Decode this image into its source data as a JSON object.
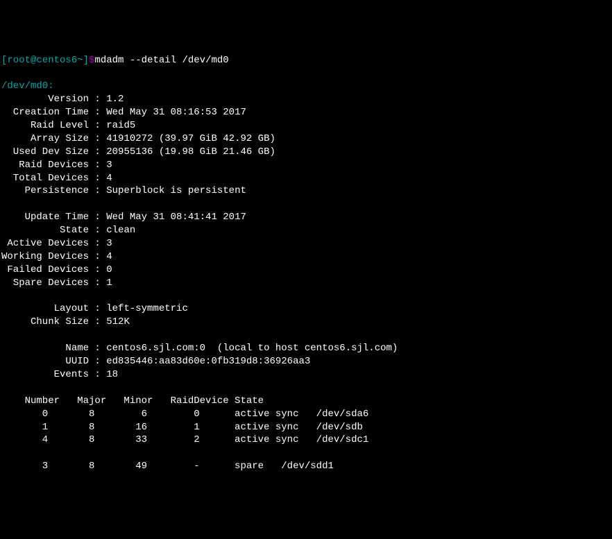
{
  "prompt": {
    "open": "[",
    "user": "root",
    "at": "@",
    "host": "centos6",
    "path": "~",
    "close": "]",
    "dollar": "$"
  },
  "command": "mdadm --detail /dev/md0",
  "device_header": "/dev/md0:",
  "details": {
    "version_label": "        Version : ",
    "version_value": "1.2",
    "creation_time_label": "  Creation Time : ",
    "creation_time_value": "Wed May 31 08:16:53 2017",
    "raid_level_label": "     Raid Level : ",
    "raid_level_value": "raid5",
    "array_size_label": "     Array Size : ",
    "array_size_value": "41910272 (39.97 GiB 42.92 GB)",
    "used_dev_size_label": "  Used Dev Size : ",
    "used_dev_size_value": "20955136 (19.98 GiB 21.46 GB)",
    "raid_devices_label": "   Raid Devices : ",
    "raid_devices_value": "3",
    "total_devices_label": "  Total Devices : ",
    "total_devices_value": "4",
    "persistence_label": "    Persistence : ",
    "persistence_value": "Superblock is persistent",
    "update_time_label": "    Update Time : ",
    "update_time_value": "Wed May 31 08:41:41 2017",
    "state_label": "          State : ",
    "state_value": "clean ",
    "active_devices_label": " Active Devices : ",
    "active_devices_value": "3",
    "working_devices_label": "Working Devices : ",
    "working_devices_value": "4",
    "failed_devices_label": " Failed Devices : ",
    "failed_devices_value": "0",
    "spare_devices_label": "  Spare Devices : ",
    "spare_devices_value": "1",
    "layout_label": "         Layout : ",
    "layout_value": "left-symmetric",
    "chunk_size_label": "     Chunk Size : ",
    "chunk_size_value": "512K",
    "name_label": "           Name : ",
    "name_value": "centos6.sjl.com:0  (local to host centos6.sjl.com)",
    "uuid_label": "           UUID : ",
    "uuid_value": "ed835446:aa83d60e:0fb319d8:36926aa3",
    "events_label": "         Events : ",
    "events_value": "18"
  },
  "table": {
    "header": "    Number   Major   Minor   RaidDevice State",
    "rows": [
      "       0       8        6        0      active sync   /dev/sda6",
      "       1       8       16        1      active sync   /dev/sdb",
      "       4       8       33        2      active sync   /dev/sdc1",
      "",
      "       3       8       49        -      spare   /dev/sdd1"
    ]
  }
}
